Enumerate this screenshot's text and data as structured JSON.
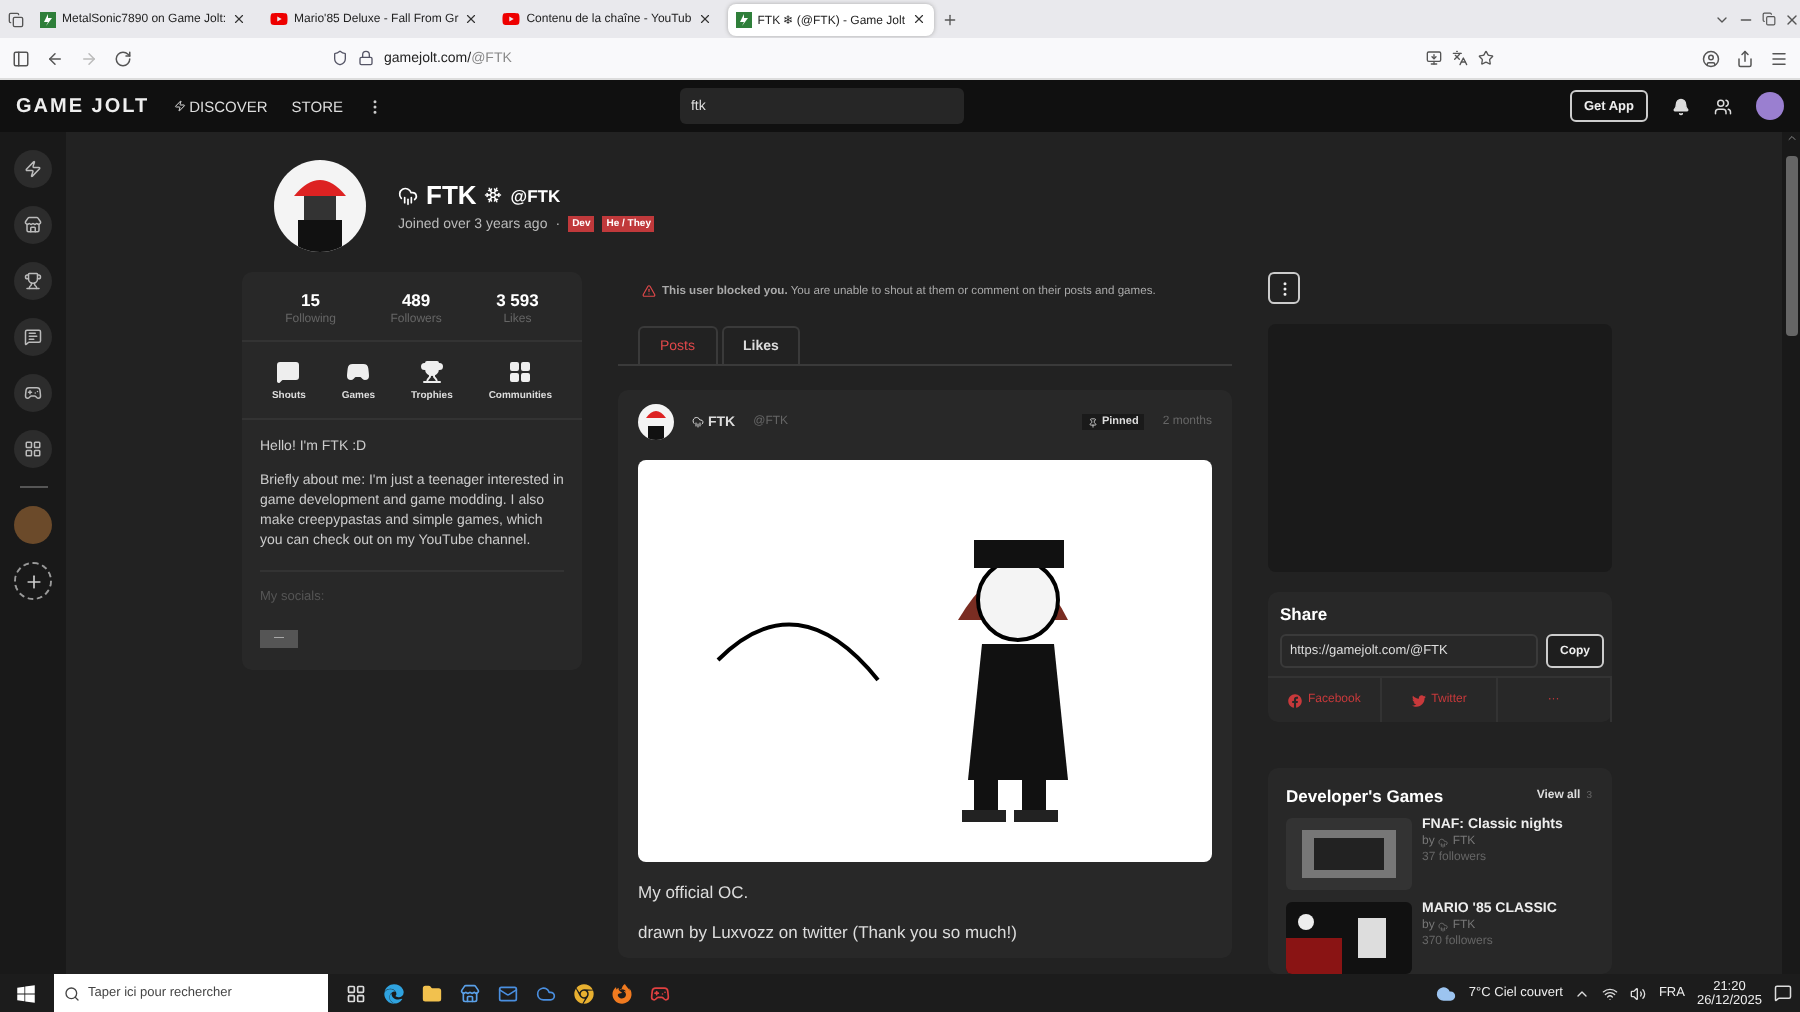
{
  "browser": {
    "tabs": [
      {
        "title": "MetalSonic7890 on Game Jolt:",
        "kind": "gamejolt",
        "selected": false
      },
      {
        "title": "Mario'85 Deluxe - Fall From Gr",
        "kind": "youtube",
        "selected": false
      },
      {
        "title": "Contenu de la chaîne - YouTub",
        "kind": "youtube",
        "selected": false
      },
      {
        "title": "FTK ❄ (@FTK) - Game Jolt",
        "kind": "gamejolt",
        "selected": true
      }
    ],
    "url_host": "gamejolt.com/",
    "url_path": "@FTK"
  },
  "site_nav": {
    "logo": "GAME JOLT",
    "links": [
      {
        "label": "DISCOVER",
        "kind": "discover"
      },
      {
        "label": "STORE",
        "kind": "store"
      }
    ],
    "search": {
      "value": "ftk"
    },
    "get_app": "Get App"
  },
  "profile": {
    "name": "FTK",
    "handle": "@FTK",
    "joined": "Joined over 3 years ago",
    "separator": "·",
    "tags": [
      {
        "label": "Dev"
      },
      {
        "label": "He / They"
      }
    ]
  },
  "stats": [
    {
      "value": "15",
      "label": "Following"
    },
    {
      "value": "489",
      "label": "Followers"
    },
    {
      "value": "3 593",
      "label": "Likes"
    }
  ],
  "sections": [
    {
      "label": "Shouts",
      "kind": "shouts"
    },
    {
      "label": "Games",
      "kind": "games"
    },
    {
      "label": "Trophies",
      "kind": "trophies"
    },
    {
      "label": "Communities",
      "kind": "communities"
    }
  ],
  "bio": {
    "paragraphs": [
      "Hello! I'm FTK :D",
      "Briefly about me: I'm just a teenager interested in game development and game modding. I also make creepypastas and simple games, which you can check out on my YouTube channel."
    ],
    "socials_label": "My socials:",
    "socials_button": "—"
  },
  "notice": "**This user blocked you.** You are unable to shout at them or comment on their posts and games.",
  "feed_tabs": [
    {
      "label": "Posts",
      "selected": true
    },
    {
      "label": "Likes",
      "selected": false
    }
  ],
  "post": {
    "author": "FTK",
    "handle": "@FTK",
    "pinned": "Pinned",
    "time": "2 months",
    "lines": [
      "My official OC.",
      "drawn by Luxvozz on twitter (Thank you so much!)"
    ]
  },
  "share": {
    "title": "Share",
    "url": "https://gamejolt.com/@FTK",
    "copy": "Copy",
    "links": [
      {
        "label": "Facebook",
        "kind": "facebook"
      },
      {
        "label": "Twitter",
        "kind": "twitter"
      },
      {
        "label": "···",
        "kind": "more"
      }
    ]
  },
  "dev_games": {
    "title": "Developer's Games",
    "view_all": "View all",
    "count": "3",
    "games": [
      {
        "title": "FNAF: Classic nights",
        "by": "by",
        "author": "FTK",
        "followers": "37 followers"
      },
      {
        "title": "MARIO '85 CLASSIC",
        "by": "by",
        "author": "FTK",
        "followers": "370 followers"
      }
    ]
  },
  "taskbar": {
    "search_placeholder": "Taper ici pour rechercher",
    "weather": "7°C  Ciel couvert",
    "language": "FRA",
    "time": "21:20",
    "date": "26/12/2025"
  }
}
